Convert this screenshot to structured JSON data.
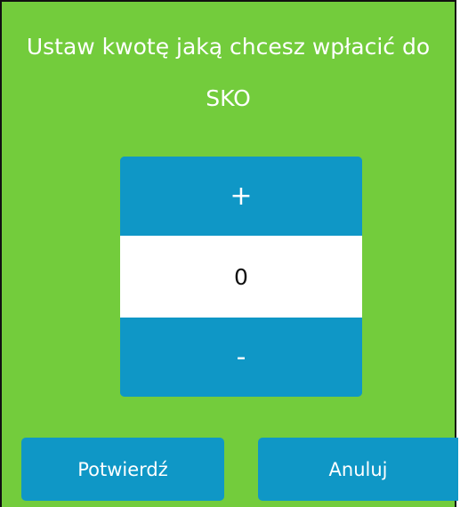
{
  "dialog": {
    "title": "Ustaw kwotę jaką chcesz wpłacić do SKO"
  },
  "stepper": {
    "increment_label": "+",
    "value": "0",
    "decrement_label": "-"
  },
  "actions": {
    "confirm_label": "Potwierdź",
    "cancel_label": "Anuluj"
  },
  "colors": {
    "background": "#73CC3C",
    "button": "#0F97C6",
    "text_light": "#FFFFFF",
    "value_bg": "#FFFFFF"
  }
}
